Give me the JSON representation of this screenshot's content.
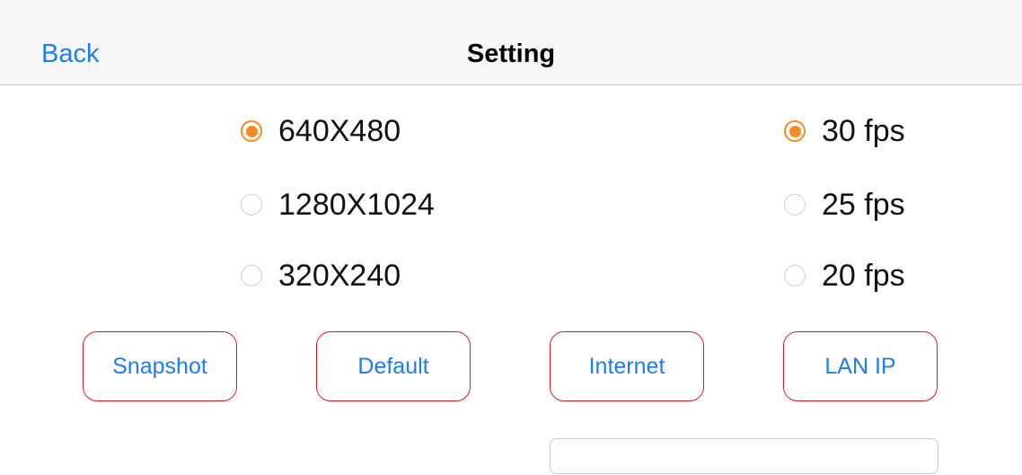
{
  "navbar": {
    "back_label": "Back",
    "title": "Setting"
  },
  "resolution": {
    "options": [
      {
        "label": "640X480",
        "selected": true
      },
      {
        "label": "1280X1024",
        "selected": false
      },
      {
        "label": "320X240",
        "selected": false
      }
    ]
  },
  "framerate": {
    "options": [
      {
        "label": "30 fps",
        "selected": true
      },
      {
        "label": "25 fps",
        "selected": false
      },
      {
        "label": "20 fps",
        "selected": false
      }
    ]
  },
  "buttons": {
    "snapshot_label": "Snapshot",
    "default_label": "Default",
    "internet_label": "Internet",
    "lan_ip_label": "LAN IP"
  },
  "ip_field": {
    "value": "",
    "placeholder": ""
  },
  "colors": {
    "accent_blue": "#1a7df5",
    "radio_orange": "#f58a1f",
    "button_border_red": "#e0141e"
  }
}
